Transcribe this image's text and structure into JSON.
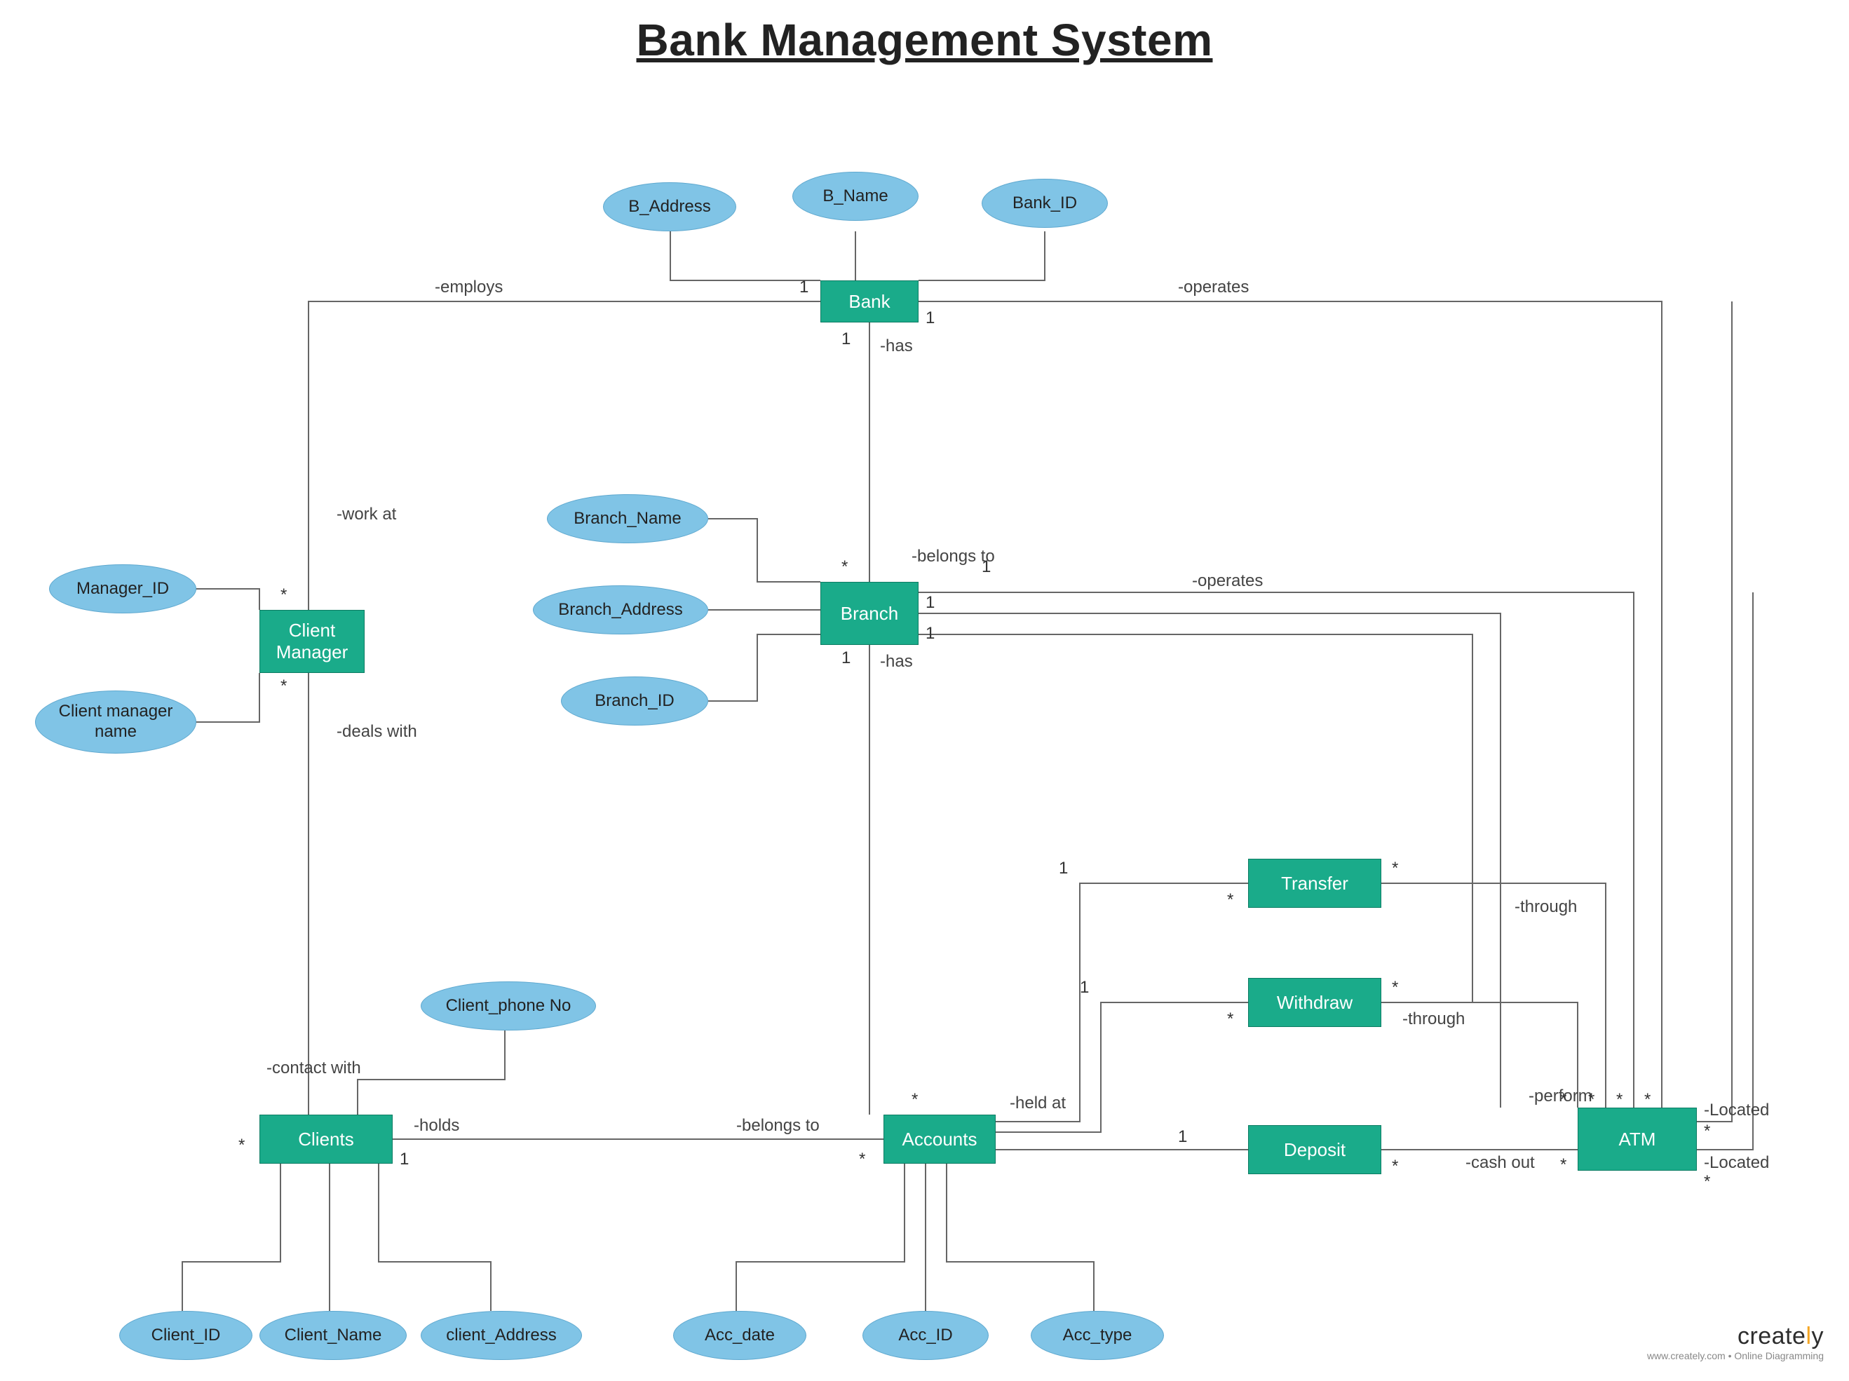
{
  "title": "Bank Management System",
  "entities": {
    "bank": "Bank",
    "branch": "Branch",
    "client_manager": "Client\nManager",
    "clients": "Clients",
    "accounts": "Accounts",
    "transfer": "Transfer",
    "withdraw": "Withdraw",
    "deposit": "Deposit",
    "atm": "ATM"
  },
  "attributes": {
    "b_address": "B_Address",
    "b_name": "B_Name",
    "bank_id": "Bank_ID",
    "branch_name": "Branch_Name",
    "branch_address": "Branch_Address",
    "branch_id": "Branch_ID",
    "manager_id": "Manager_ID",
    "client_manager_name": "Client manager\nname",
    "client_phone_no": "Client_phone No",
    "client_id": "Client_ID",
    "client_name": "Client_Name",
    "client_address": "client_Address",
    "acc_date": "Acc_date",
    "acc_id": "Acc_ID",
    "acc_type": "Acc_type"
  },
  "relationships": {
    "employs": "-employs",
    "operates_bank": "-operates",
    "has_bank": "-has",
    "work_at": "-work at",
    "belongs_to_branch": "-belongs to",
    "operates_branch": "-operates",
    "has_branch": "-has",
    "deals_with": "-deals with",
    "contact_with": "-contact  with",
    "holds": "-holds",
    "belongs_to_acc": "-belongs to",
    "held_at": "-held at",
    "through_t": "-through",
    "through_w": "-through",
    "perform": "-perform",
    "cash_out": "-cash out",
    "located1": "-Located",
    "located2": "-Located"
  },
  "cardinalities": {
    "one": "1",
    "many": "*"
  },
  "logo": {
    "brand": "creately",
    "sub": "www.creately.com • Online Diagramming"
  }
}
